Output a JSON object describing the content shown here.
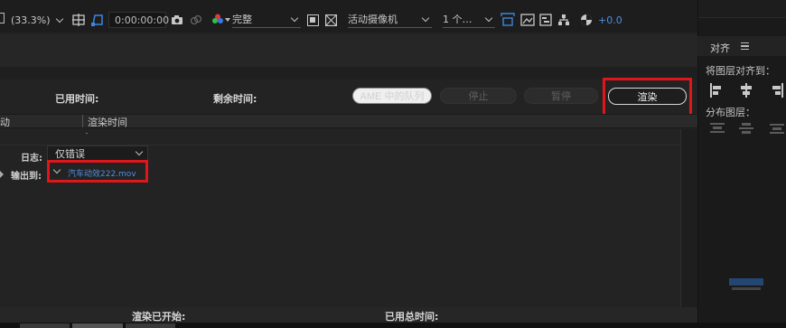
{
  "toolbar": {
    "zoom": "(33.3%)",
    "timecode": "0:00:00:00",
    "resolution": "完整",
    "camera": "活动摄像机",
    "views": "1 个…",
    "exposure": "+0.0"
  },
  "align_panel": {
    "title": "对齐",
    "align_to_label": "将图层对齐到：",
    "distribute_label": "分布图层："
  },
  "render_queue": {
    "elapsed_label": "已用时间:",
    "remaining_label": "剩余时间:",
    "ame_queue_button": "AME 中的队列",
    "stop_button": "停止",
    "pause_button": "暂停",
    "render_button": "渲染",
    "columns": [
      "动",
      "渲染时间"
    ],
    "log_label": "日志:",
    "log_value": "仅错误",
    "output_label": "输出到:",
    "output_file": "汽车动效222.mov",
    "render_started_label": "渲染已开始:",
    "total_elapsed_label": "已用总时间:"
  },
  "colors": {
    "highlight": "#e0161a",
    "link": "#4e8fe0",
    "exposure": "#4e8fe0"
  }
}
